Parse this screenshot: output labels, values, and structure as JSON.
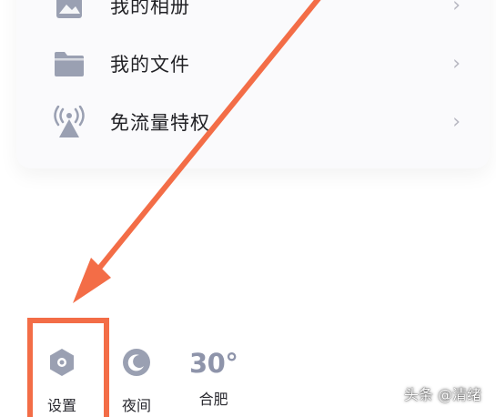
{
  "menu": {
    "items": [
      {
        "label": "我的相册",
        "icon": "photo-album-icon"
      },
      {
        "label": "我的文件",
        "icon": "folder-icon"
      },
      {
        "label": "免流量特权",
        "icon": "signal-tower-icon"
      }
    ],
    "chevron": "›"
  },
  "bottom_bar": {
    "settings_label": "设置",
    "settings_icon": "settings-hexagon-icon",
    "night_label": "夜间",
    "night_icon": "moon-icon",
    "weather_temp": "30°",
    "weather_city": "合肥"
  },
  "annotation": {
    "color": "#f36d47",
    "arrow": "pointing-to-settings"
  },
  "watermark": "头条 @清绪",
  "colors": {
    "icon_gray": "#9aa0b2",
    "text": "#222226",
    "chevron": "#b8b8c2",
    "accent_orange": "#f36d47"
  }
}
